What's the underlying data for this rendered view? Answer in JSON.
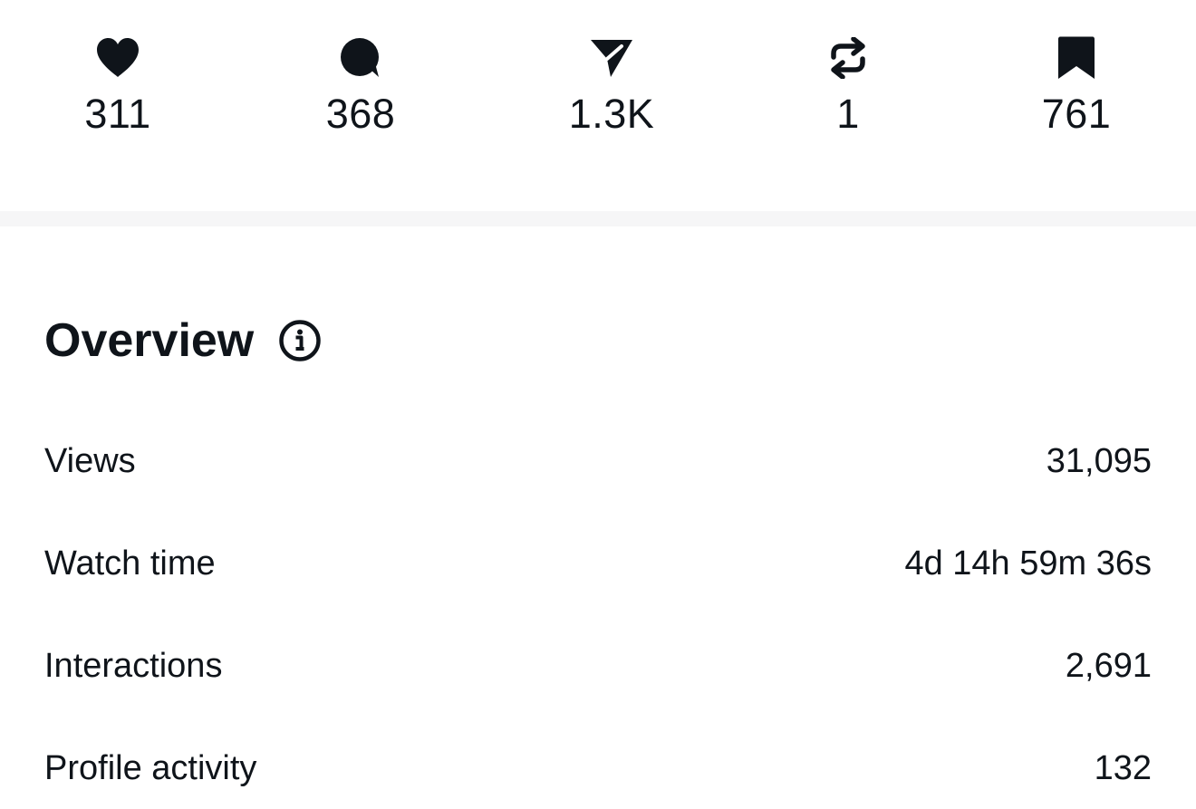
{
  "engagement": {
    "likes": {
      "icon": "heart-icon",
      "count": "311"
    },
    "comments": {
      "icon": "comment-icon",
      "count": "368"
    },
    "shares": {
      "icon": "send-icon",
      "count": "1.3K"
    },
    "reposts": {
      "icon": "repost-icon",
      "count": "1"
    },
    "saves": {
      "icon": "bookmark-icon",
      "count": "761"
    }
  },
  "overview": {
    "title": "Overview",
    "info_icon": "info-icon",
    "metrics": [
      {
        "label": "Views",
        "value": "31,095"
      },
      {
        "label": "Watch time",
        "value": "4d 14h 59m 36s"
      },
      {
        "label": "Interactions",
        "value": "2,691"
      },
      {
        "label": "Profile activity",
        "value": "132"
      }
    ]
  },
  "colors": {
    "text": "#0f141a",
    "divider": "#f6f6f7",
    "background": "#ffffff"
  }
}
